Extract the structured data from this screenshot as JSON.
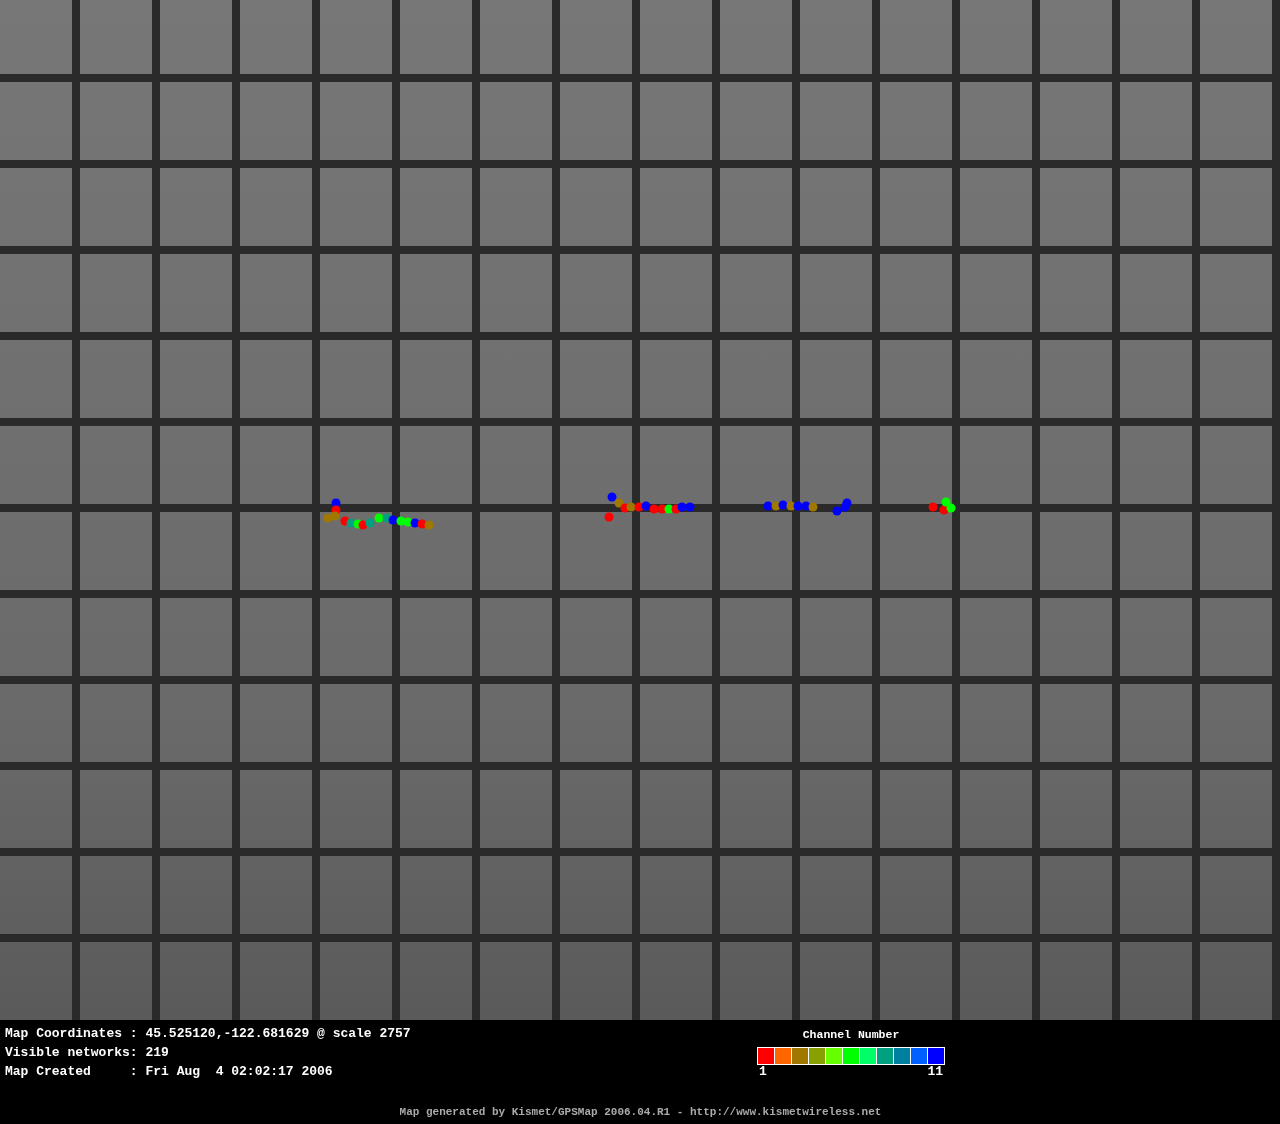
{
  "map": {
    "dots": [
      {
        "color": "#0000ff"
      },
      {
        "color": "#ff0000"
      },
      {
        "color": "#a07800"
      },
      {
        "color": "#a07800"
      },
      {
        "color": "#ff0000"
      },
      {
        "color": "#00a080"
      },
      {
        "color": "#00ff00"
      },
      {
        "color": "#ff0000"
      },
      {
        "color": "#00a080"
      },
      {
        "color": "#00ff00"
      },
      {
        "color": "#00a080"
      },
      {
        "color": "#0000ff"
      },
      {
        "color": "#00ff00"
      },
      {
        "color": "#00ff00"
      },
      {
        "color": "#0000ff"
      },
      {
        "color": "#ff0000"
      },
      {
        "color": "#a07800"
      },
      {
        "color": "#0000ff"
      },
      {
        "color": "#a07800"
      },
      {
        "color": "#ff0000"
      },
      {
        "color": "#ff0000"
      },
      {
        "color": "#a07800"
      },
      {
        "color": "#ff0000"
      },
      {
        "color": "#0000ff"
      },
      {
        "color": "#ff0000"
      },
      {
        "color": "#ff0000"
      },
      {
        "color": "#00ff00"
      },
      {
        "color": "#ff0000"
      },
      {
        "color": "#0000ff"
      },
      {
        "color": "#0000ff"
      },
      {
        "color": "#0000ff"
      },
      {
        "color": "#a07800"
      },
      {
        "color": "#0000ff"
      },
      {
        "color": "#a07800"
      },
      {
        "color": "#0000ff"
      },
      {
        "color": "#0000ff"
      },
      {
        "color": "#a07800"
      },
      {
        "color": "#0000ff"
      },
      {
        "color": "#0000ff"
      },
      {
        "color": "#0000ff"
      },
      {
        "color": "#ff0000"
      },
      {
        "color": "#ff0000"
      },
      {
        "color": "#00ff00"
      },
      {
        "color": "#00ff00"
      }
    ]
  },
  "info_lines": [
    "Map Coordinates : 45.525120,-122.681629 @ scale 2757",
    "Visible networks: 219",
    "Map Created     : Fri Aug  4 02:02:17 2006"
  ],
  "legend": {
    "title": "Channel Number",
    "swatches": [
      {
        "color": "#ff0000"
      },
      {
        "color": "#ff6600"
      },
      {
        "color": "#a07800"
      },
      {
        "color": "#88a000"
      },
      {
        "color": "#66ff00"
      },
      {
        "color": "#00ff00"
      },
      {
        "color": "#00ff66"
      },
      {
        "color": "#00a080"
      },
      {
        "color": "#0080a0"
      },
      {
        "color": "#0060ff"
      },
      {
        "color": "#0000ff"
      }
    ],
    "min_label": "1",
    "max_label": "11"
  },
  "footer": "Map generated by Kismet/GPSMap 2006.04.R1 - http://www.kismetwireless.net"
}
